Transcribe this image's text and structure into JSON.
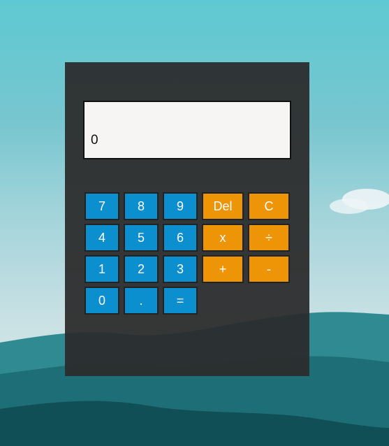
{
  "display": {
    "value": "0"
  },
  "keys": {
    "seven": "7",
    "eight": "8",
    "nine": "9",
    "del": "Del",
    "clear": "C",
    "four": "4",
    "five": "5",
    "six": "6",
    "multiply": "x",
    "divide": "÷",
    "one": "1",
    "two": "2",
    "three": "3",
    "add": "+",
    "subtract": "-",
    "zero": "0",
    "decimal": ".",
    "equals": "="
  },
  "colors": {
    "number_key": "#0b8fcf",
    "operator_key": "#ee9507",
    "panel": "#2c2c2c",
    "display": "#f7f5f3"
  }
}
